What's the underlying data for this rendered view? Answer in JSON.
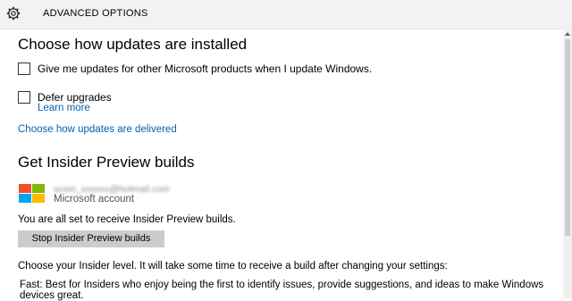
{
  "header": {
    "title": "ADVANCED OPTIONS",
    "icon": "gear-icon"
  },
  "install": {
    "heading": "Choose how updates are installed",
    "option_microsoft_products": "Give me updates for other Microsoft products when I update Windows.",
    "option_defer": "Defer upgrades",
    "learn_more": "Learn more",
    "delivery_link": "Choose how updates are delivered"
  },
  "insider": {
    "heading": "Get Insider Preview builds",
    "account_email": "scom_xxxxxx@hotmail.com",
    "account_type": "Microsoft account",
    "status": "You are all set to receive Insider Preview builds.",
    "stop_button": "Stop Insider Preview builds",
    "level_prompt": "Choose your Insider level. It will take some time to receive a build after changing your settings:",
    "fast_description": "Fast: Best for Insiders who enjoy being the first to identify issues, provide suggestions, and ideas to make Windows devices great."
  },
  "colors": {
    "link": "#0063b1",
    "button_bg": "#cccccc"
  }
}
